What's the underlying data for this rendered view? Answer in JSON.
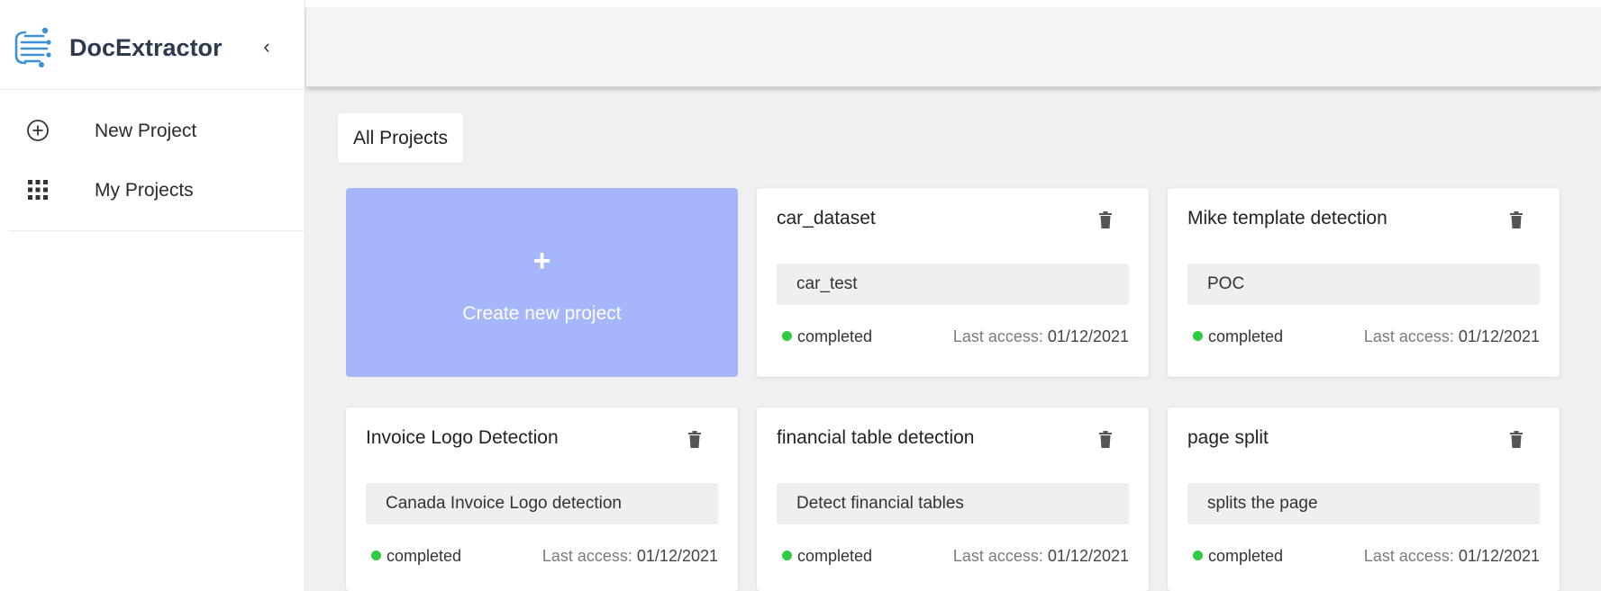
{
  "app": {
    "name": "DocExtractor",
    "collapse_icon": "chevron-left-icon"
  },
  "sidebar": {
    "items": [
      {
        "label": "New Project",
        "icon": "plus-circle-icon"
      },
      {
        "label": "My Projects",
        "icon": "grid-icon"
      }
    ]
  },
  "main": {
    "tab": "All Projects",
    "create_card": {
      "plus": "+",
      "label": "Create new project",
      "color": "#a6b6fa"
    },
    "projects": [
      {
        "title": "car_dataset",
        "description": "car_test",
        "status": "completed",
        "access_label": "Last access:",
        "access_date": "01/12/2021"
      },
      {
        "title": "Mike template detection",
        "description": "POC",
        "status": "completed",
        "access_label": "Last access:",
        "access_date": "01/12/2021"
      },
      {
        "title": "Invoice Logo Detection",
        "description": "Canada Invoice Logo detection",
        "status": "completed",
        "access_label": "Last access:",
        "access_date": "01/12/2021"
      },
      {
        "title": "financial table detection",
        "description": "Detect financial tables",
        "status": "completed",
        "access_label": "Last access:",
        "access_date": "01/12/2021"
      },
      {
        "title": "page split",
        "description": "splits the page",
        "status": "completed",
        "access_label": "Last access:",
        "access_date": "01/12/2021"
      }
    ],
    "status_color": "#2ecc40"
  }
}
